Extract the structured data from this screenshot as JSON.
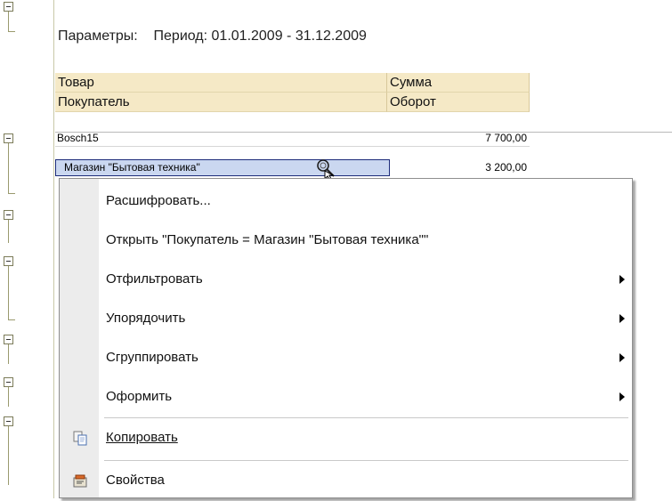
{
  "params": {
    "label": "Параметры:",
    "period": "Период: 01.01.2009 - 31.12.2009"
  },
  "table": {
    "headers": {
      "col1_row1": "Товар",
      "col1_row2": "Покупатель",
      "col2_row1": "Сумма",
      "col2_row2": "Оборот"
    },
    "group_row": {
      "name": "Bosch15",
      "value": "7 700,00"
    },
    "detail_row": {
      "name": "Магазин \"Бытовая техника\"",
      "value": "3 200,00"
    }
  },
  "context_menu": {
    "items": [
      {
        "label": "Расшифровать...",
        "submenu": false,
        "icon": ""
      },
      {
        "label": "Открыть \"Покупатель = Магазин \"Бытовая техника\"\"",
        "submenu": false,
        "icon": ""
      },
      {
        "label": "Отфильтровать",
        "submenu": true,
        "icon": ""
      },
      {
        "label": "Упорядочить",
        "submenu": true,
        "icon": ""
      },
      {
        "label": "Сгруппировать",
        "submenu": true,
        "icon": ""
      },
      {
        "label": "Оформить",
        "submenu": true,
        "icon": ""
      },
      {
        "label": "Копировать",
        "submenu": false,
        "icon": "copy-icon"
      },
      {
        "label": "Свойства",
        "submenu": false,
        "icon": "properties-icon"
      }
    ]
  },
  "colors": {
    "header_bg": "#f5e9c6",
    "selection_bg": "#cad7f0",
    "selection_border": "#1c2b7a",
    "menu_strip": "#ececec"
  }
}
